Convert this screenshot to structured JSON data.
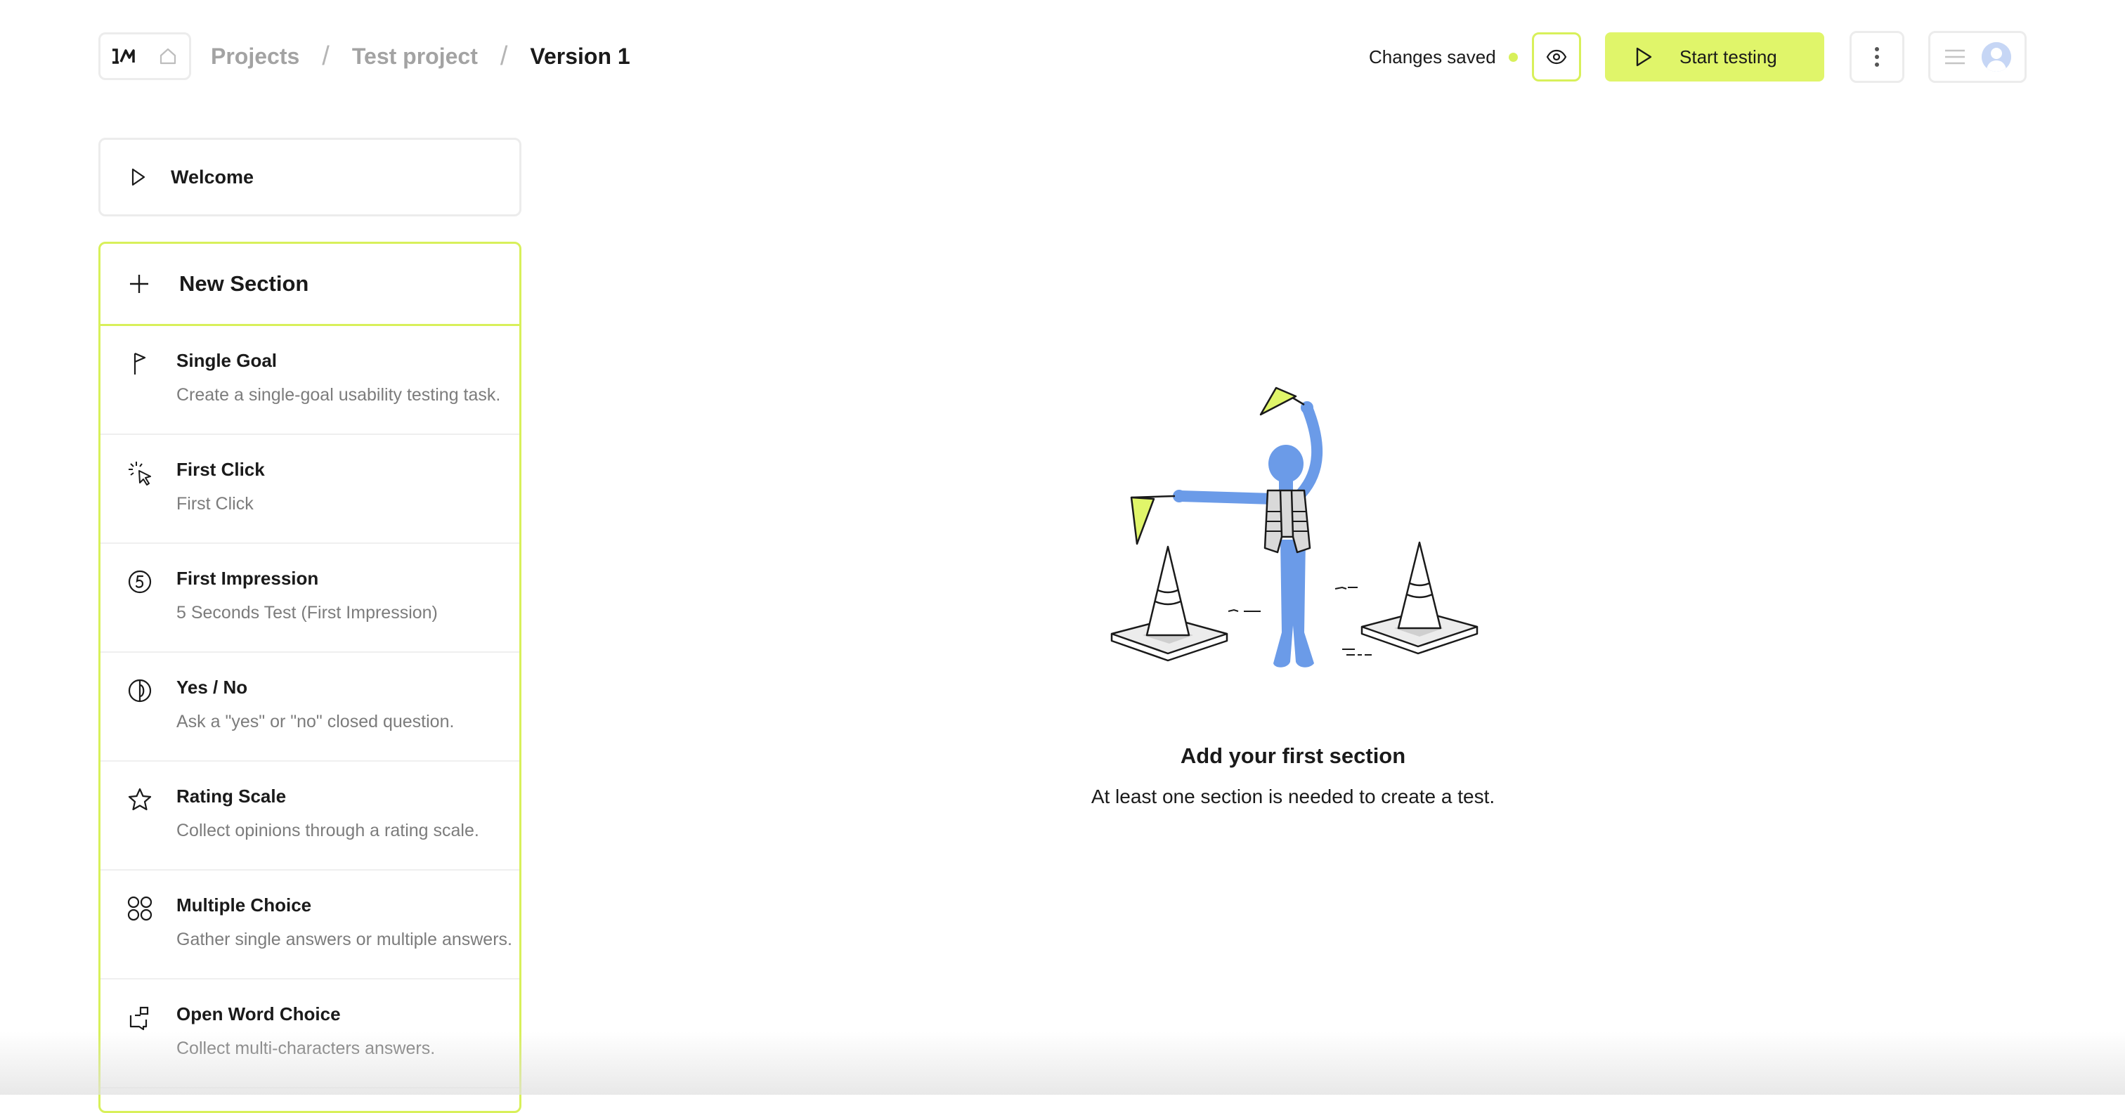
{
  "header": {
    "breadcrumb": {
      "projects": "Projects",
      "project": "Test project",
      "version": "Version 1",
      "separator": "/"
    },
    "status": {
      "text": "Changes saved",
      "color": "#d8f05a"
    },
    "start_testing": "Start testing"
  },
  "welcome": {
    "label": "Welcome"
  },
  "new_section": {
    "label": "New Section",
    "options": [
      {
        "icon": "flag-icon",
        "title": "Single Goal",
        "desc": "Create a single-goal usability testing task."
      },
      {
        "icon": "click-icon",
        "title": "First Click",
        "desc": "First Click"
      },
      {
        "icon": "five-seconds-icon",
        "title": "First Impression",
        "desc": "5 Seconds Test (First Impression)"
      },
      {
        "icon": "yes-no-icon",
        "title": "Yes / No",
        "desc": "Ask a \"yes\" or \"no\" closed question."
      },
      {
        "icon": "star-icon",
        "title": "Rating Scale",
        "desc": "Collect opinions through a rating scale."
      },
      {
        "icon": "multiple-choice-icon",
        "title": "Multiple Choice",
        "desc": "Gather single answers or multiple answers."
      },
      {
        "icon": "open-word-icon",
        "title": "Open Word Choice",
        "desc": "Collect multi-characters answers."
      }
    ]
  },
  "empty_state": {
    "title": "Add your first section",
    "subtitle": "At least one section is needed to create a test."
  },
  "colors": {
    "accent": "#e0f56a",
    "accent_border": "#d8f05a",
    "figure_blue": "#6b9be8"
  }
}
